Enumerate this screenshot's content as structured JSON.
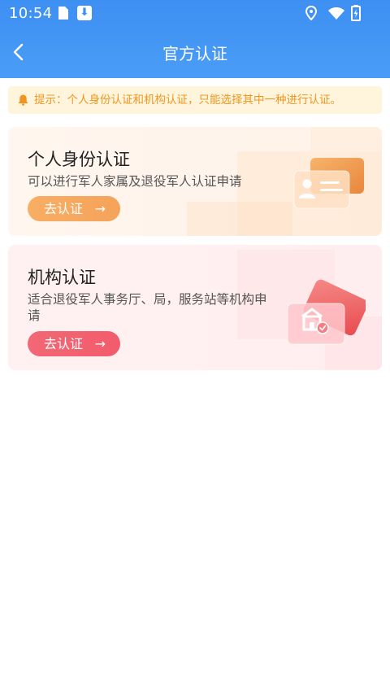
{
  "status_bar": {
    "time": "10:54",
    "icons": [
      "sim-card-icon",
      "download-icon",
      "location-icon",
      "wifi-icon",
      "battery-icon"
    ]
  },
  "header": {
    "title": "官方认证",
    "back_icon": "back-arrow-icon"
  },
  "notice": {
    "text": "提示：个人身份认证和机构认证，只能选择其中一种进行认证。",
    "icon": "bell-icon"
  },
  "cards": [
    {
      "title": "个人身份认证",
      "description": "可以进行军人家属及退役军人认证申请",
      "button_label": "去认证",
      "button_arrow": "→",
      "accent_color": "#f5a35a"
    },
    {
      "title": "机构认证",
      "description": "适合退役军人事务厅、局，服务站等机构申请",
      "button_label": "去认证",
      "button_arrow": "→",
      "accent_color": "#f25c6c"
    }
  ],
  "colors": {
    "header": "#4a9df6",
    "notice_bg": "#fff4dc",
    "notice_text": "#f0961e"
  }
}
